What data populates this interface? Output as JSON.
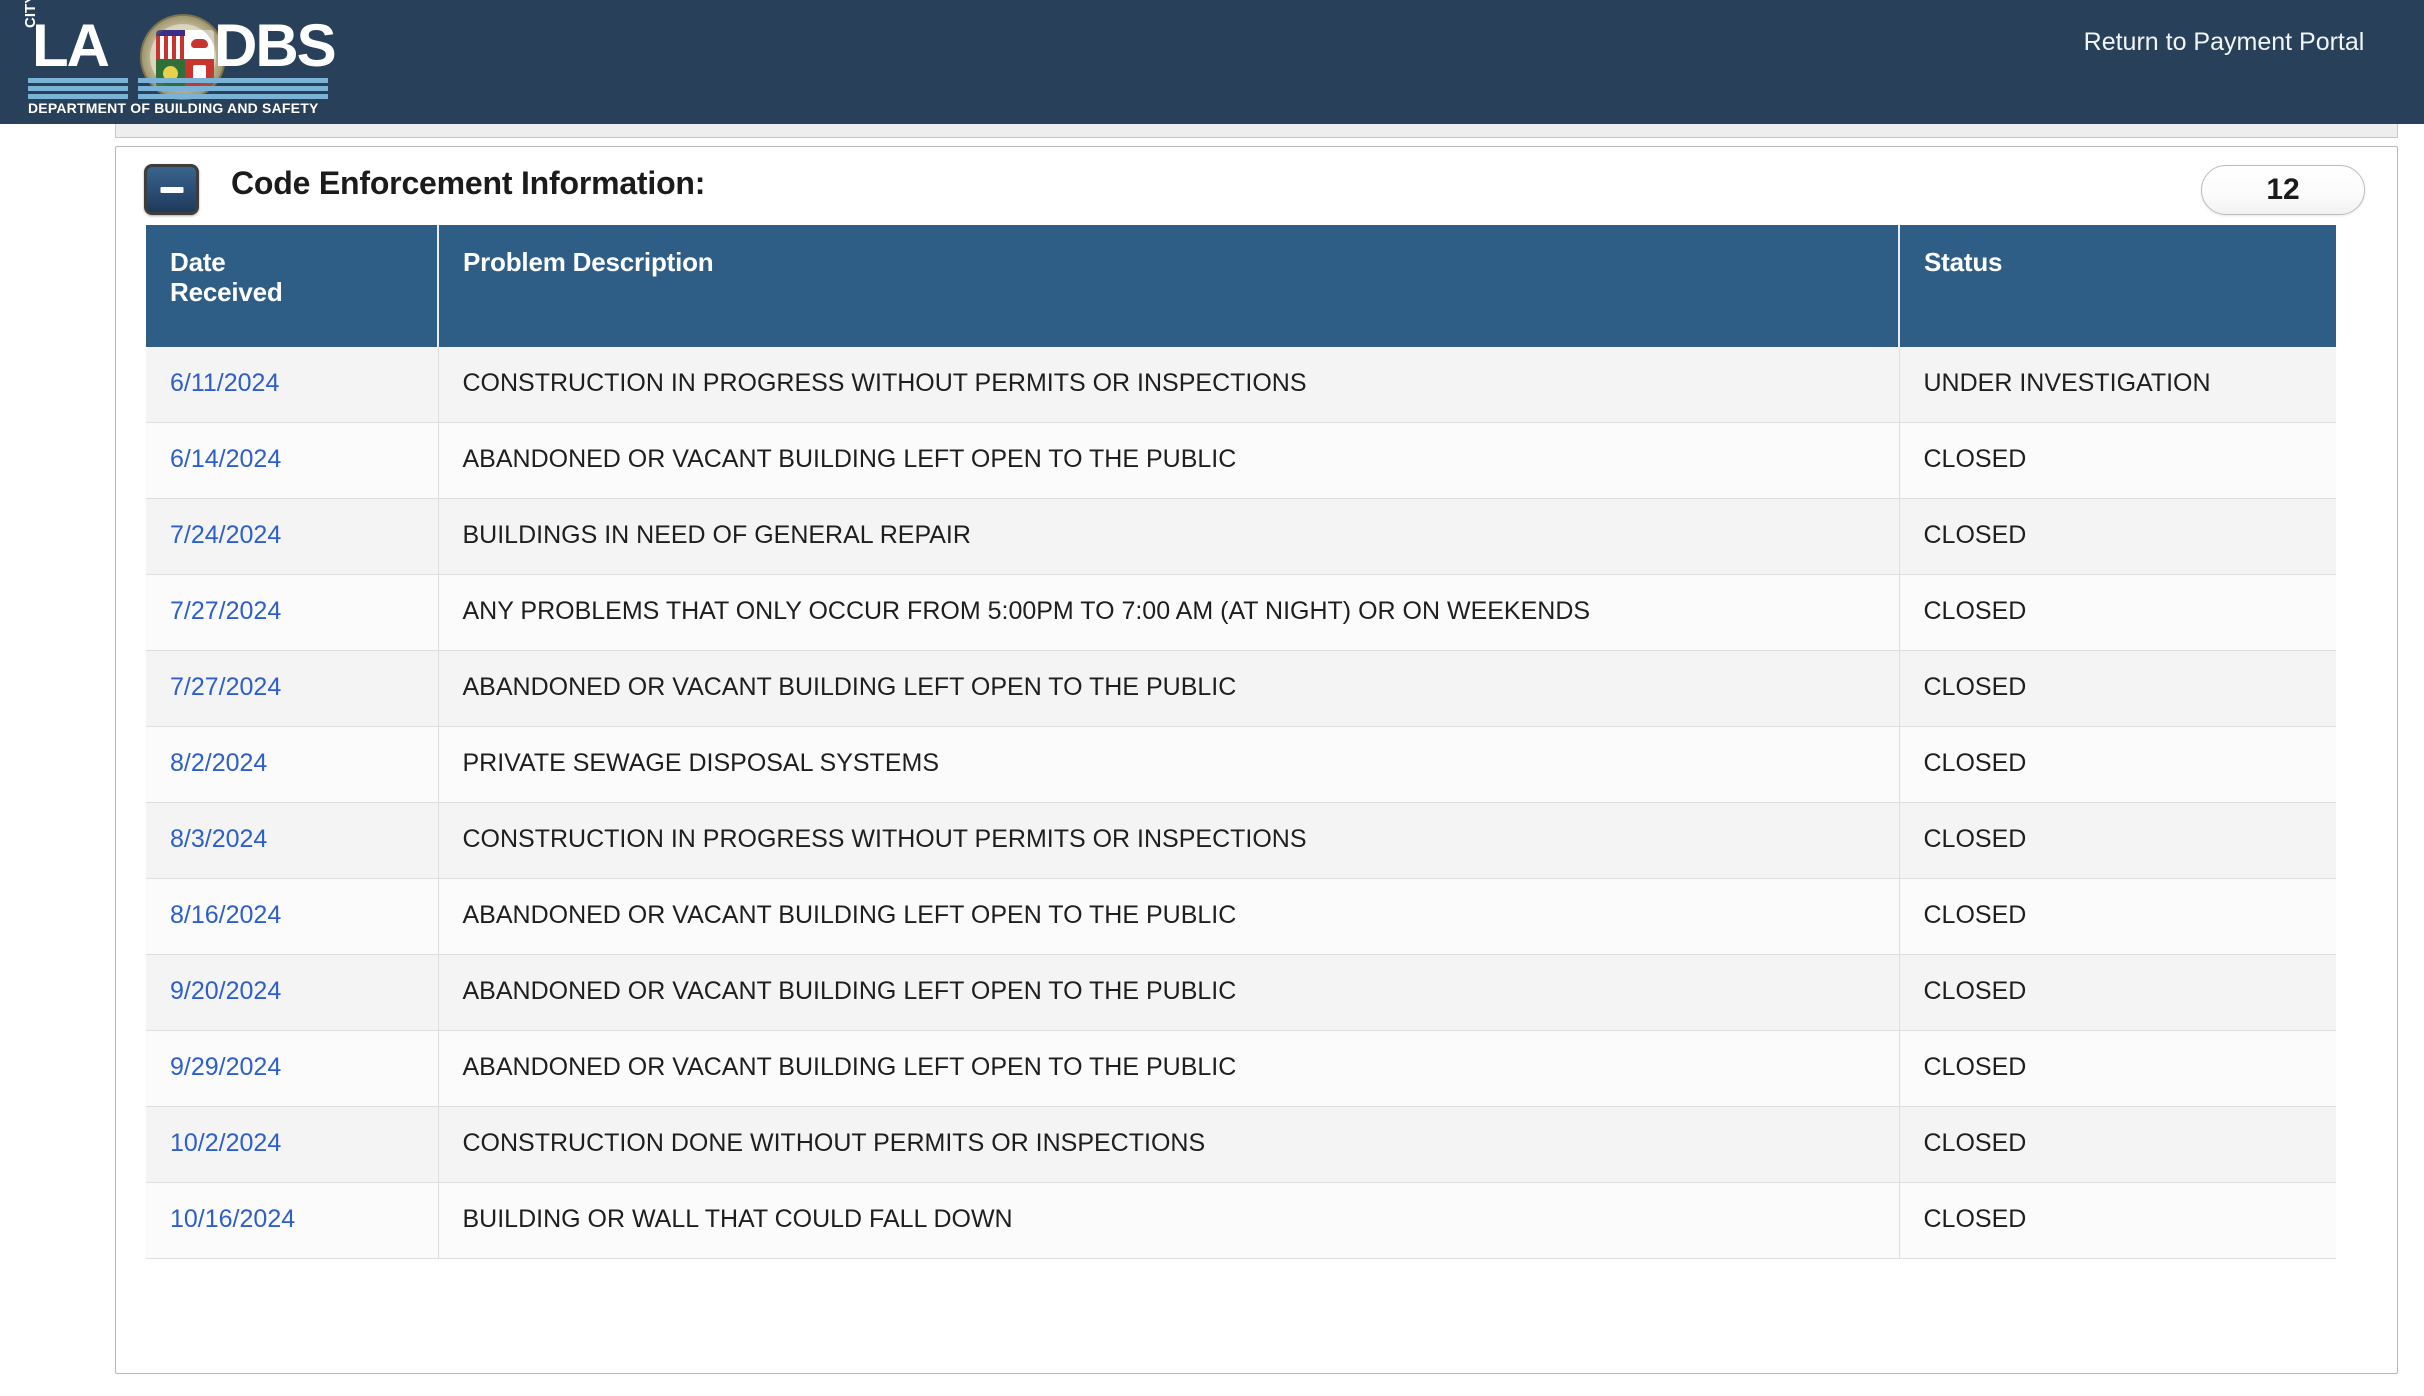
{
  "header": {
    "logo": {
      "city_text": "CITY",
      "la_text": "LA",
      "dbs_text": "DBS",
      "tagline": "DEPARTMENT OF BUILDING AND SAFETY",
      "seal_icon": "los-angeles-city-seal-icon"
    },
    "return_link": "Return to Payment Portal",
    "background_color": "#29405a"
  },
  "panel": {
    "collapse_icon": "minus-icon",
    "title": "Code Enforcement Information:",
    "count_badge": "12",
    "header_bg_color": "#2e5d86",
    "link_color": "#2c5fc9"
  },
  "table": {
    "columns": [
      {
        "label": "Date Received",
        "line1": "Date",
        "line2": "Received"
      },
      {
        "label": "Problem Description",
        "line1": "Problem Description",
        "line2": ""
      },
      {
        "label": "Status",
        "line1": "Status",
        "line2": ""
      }
    ],
    "rows": [
      {
        "date": "6/11/2024",
        "description": "CONSTRUCTION IN PROGRESS WITHOUT PERMITS OR INSPECTIONS",
        "status": "UNDER INVESTIGATION"
      },
      {
        "date": "6/14/2024",
        "description": "ABANDONED OR VACANT BUILDING LEFT OPEN TO THE PUBLIC",
        "status": "CLOSED"
      },
      {
        "date": "7/24/2024",
        "description": "BUILDINGS IN NEED OF GENERAL REPAIR",
        "status": "CLOSED"
      },
      {
        "date": "7/27/2024",
        "description": "ANY PROBLEMS THAT ONLY OCCUR FROM 5:00PM TO 7:00 AM (AT NIGHT) OR ON WEEKENDS",
        "status": "CLOSED"
      },
      {
        "date": "7/27/2024",
        "description": "ABANDONED OR VACANT BUILDING LEFT OPEN TO THE PUBLIC",
        "status": "CLOSED"
      },
      {
        "date": "8/2/2024",
        "description": "PRIVATE SEWAGE DISPOSAL SYSTEMS",
        "status": "CLOSED"
      },
      {
        "date": "8/3/2024",
        "description": "CONSTRUCTION IN PROGRESS WITHOUT PERMITS OR INSPECTIONS",
        "status": "CLOSED"
      },
      {
        "date": "8/16/2024",
        "description": "ABANDONED OR VACANT BUILDING LEFT OPEN TO THE PUBLIC",
        "status": "CLOSED"
      },
      {
        "date": "9/20/2024",
        "description": "ABANDONED OR VACANT BUILDING LEFT OPEN TO THE PUBLIC",
        "status": "CLOSED"
      },
      {
        "date": "9/29/2024",
        "description": "ABANDONED OR VACANT BUILDING LEFT OPEN TO THE PUBLIC",
        "status": "CLOSED"
      },
      {
        "date": "10/2/2024",
        "description": "CONSTRUCTION DONE WITHOUT PERMITS OR INSPECTIONS",
        "status": "CLOSED"
      },
      {
        "date": "10/16/2024",
        "description": "BUILDING OR WALL THAT COULD FALL DOWN",
        "status": "CLOSED"
      }
    ]
  }
}
